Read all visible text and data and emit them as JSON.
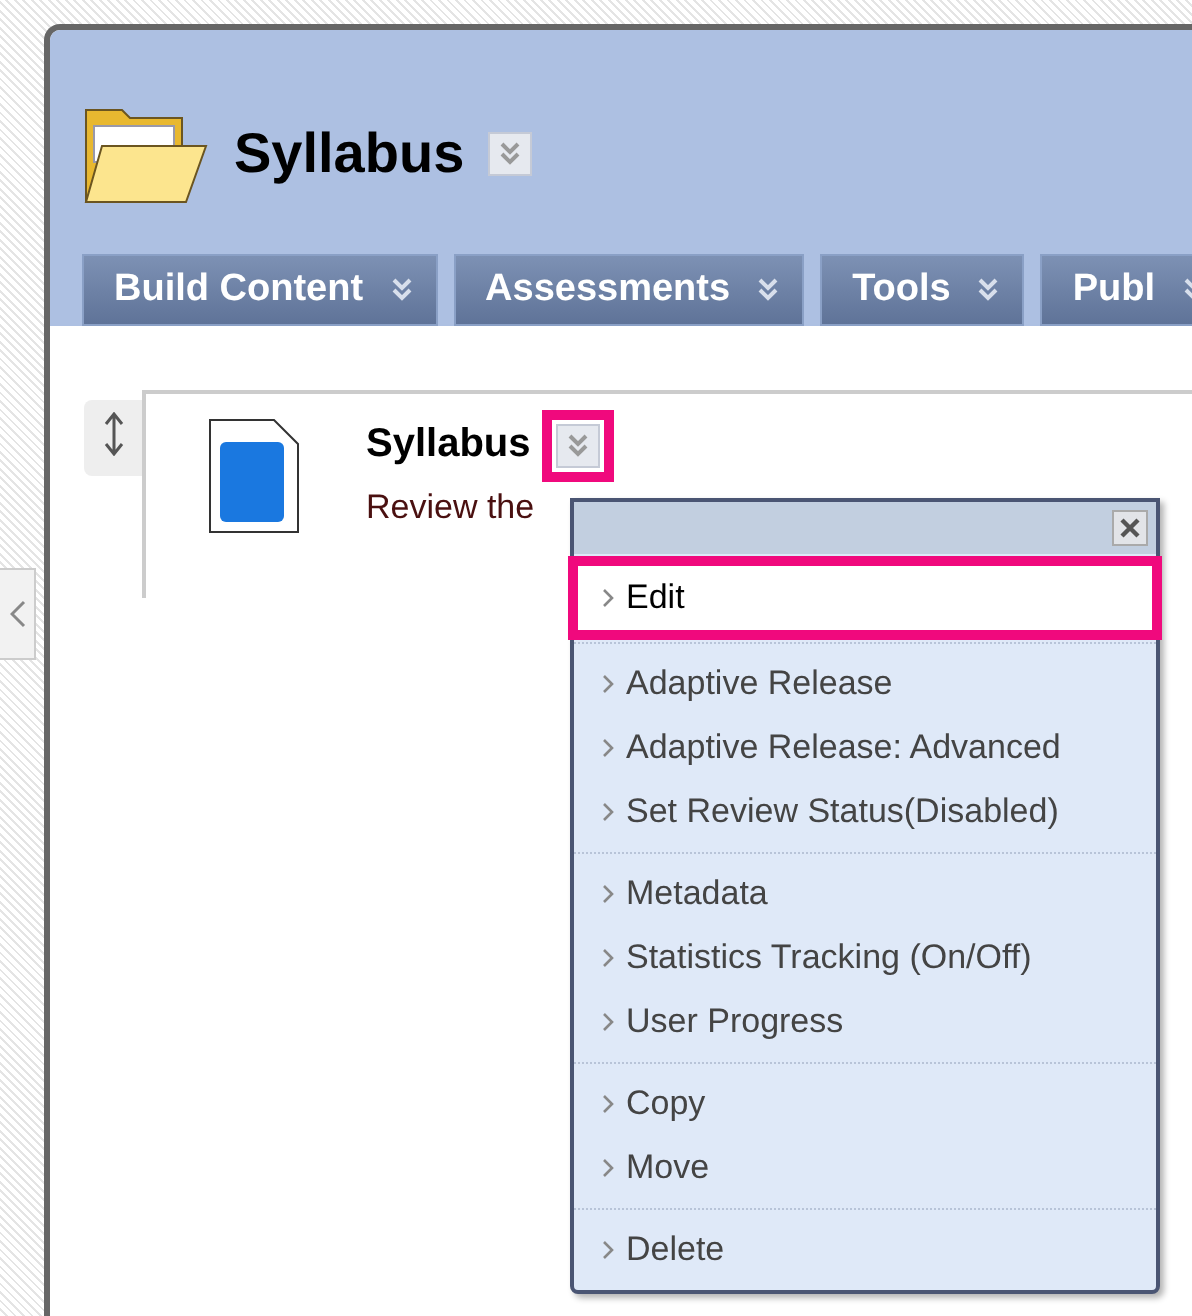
{
  "page": {
    "title": "Syllabus"
  },
  "toolbar": [
    {
      "label": "Build Content"
    },
    {
      "label": "Assessments"
    },
    {
      "label": "Tools"
    },
    {
      "label": "Publ"
    }
  ],
  "content_item": {
    "title": "Syllabus",
    "description": "Review the",
    "menu_button_highlighted": true
  },
  "context_menu": {
    "groups": [
      [
        {
          "label": "Edit",
          "selected": true
        }
      ],
      [
        {
          "label": "Adaptive Release",
          "selected": false
        },
        {
          "label": "Adaptive Release: Advanced",
          "selected": false
        },
        {
          "label": "Set Review Status(Disabled)",
          "selected": false
        }
      ],
      [
        {
          "label": "Metadata",
          "selected": false
        },
        {
          "label": "Statistics Tracking (On/Off)",
          "selected": false
        },
        {
          "label": "User Progress",
          "selected": false
        }
      ],
      [
        {
          "label": "Copy",
          "selected": false
        },
        {
          "label": "Move",
          "selected": false
        }
      ],
      [
        {
          "label": "Delete",
          "selected": false
        }
      ]
    ]
  }
}
